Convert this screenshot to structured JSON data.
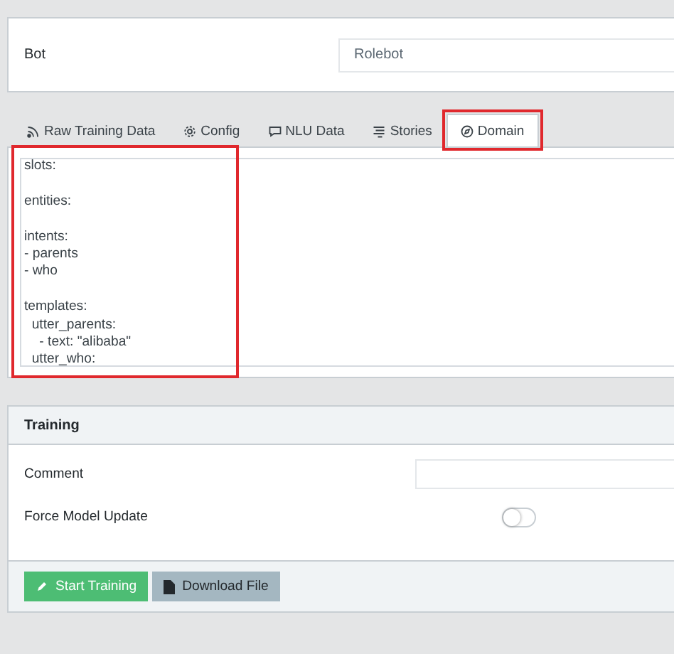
{
  "bot": {
    "label": "Bot",
    "value": "Rolebot"
  },
  "tabs": [
    {
      "label": "Raw Training Data",
      "kind": "feed",
      "selected": false,
      "highlighted": false
    },
    {
      "label": "Config",
      "kind": "gear",
      "selected": false,
      "highlighted": false
    },
    {
      "label": "NLU Data",
      "kind": "chat",
      "selected": false,
      "highlighted": false
    },
    {
      "label": "Stories",
      "kind": "stack",
      "selected": false,
      "highlighted": false
    },
    {
      "label": "Domain",
      "kind": "compass",
      "selected": true,
      "highlighted": true
    }
  ],
  "editor": {
    "text": "slots:\n\nentities:\n\nintents:\n- parents\n- who\n\ntemplates:\n  utter_parents:\n    - text: \"alibaba\"\n  utter_who:",
    "highlighted": true
  },
  "training": {
    "title": "Training",
    "fields": [
      {
        "kind": "text",
        "label": "Comment"
      },
      {
        "kind": "switch",
        "label": "Force Model Update",
        "on": false
      }
    ],
    "buttons": [
      {
        "kind": "start",
        "label": "Start Training"
      },
      {
        "kind": "download",
        "label": "Download File"
      }
    ]
  }
}
